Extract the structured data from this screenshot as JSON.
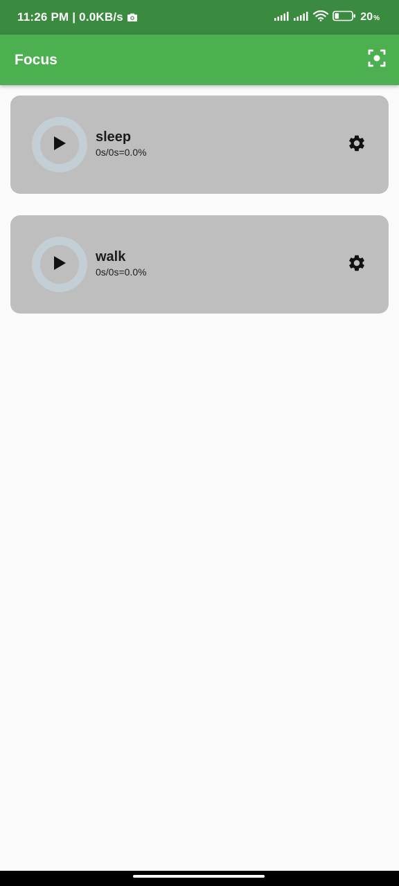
{
  "status_bar": {
    "time_text": "11:26 PM | 0.0KB/s",
    "battery_value": "20",
    "battery_unit": "%"
  },
  "app_bar": {
    "title": "Focus",
    "action_icon": "focus-scan-icon"
  },
  "cards": [
    {
      "name": "sleep",
      "progress": "0s/0s=0.0%",
      "play_icon": "play-icon",
      "settings_icon": "gear-icon"
    },
    {
      "name": "walk",
      "progress": "0s/0s=0.0%",
      "play_icon": "play-icon",
      "settings_icon": "gear-icon"
    }
  ],
  "colors": {
    "status_bar": "#3a8a3f",
    "app_bar": "#4caf50",
    "card_background": "#bebebe",
    "ring": "#c3cfd5",
    "page_background": "#fafafa"
  }
}
